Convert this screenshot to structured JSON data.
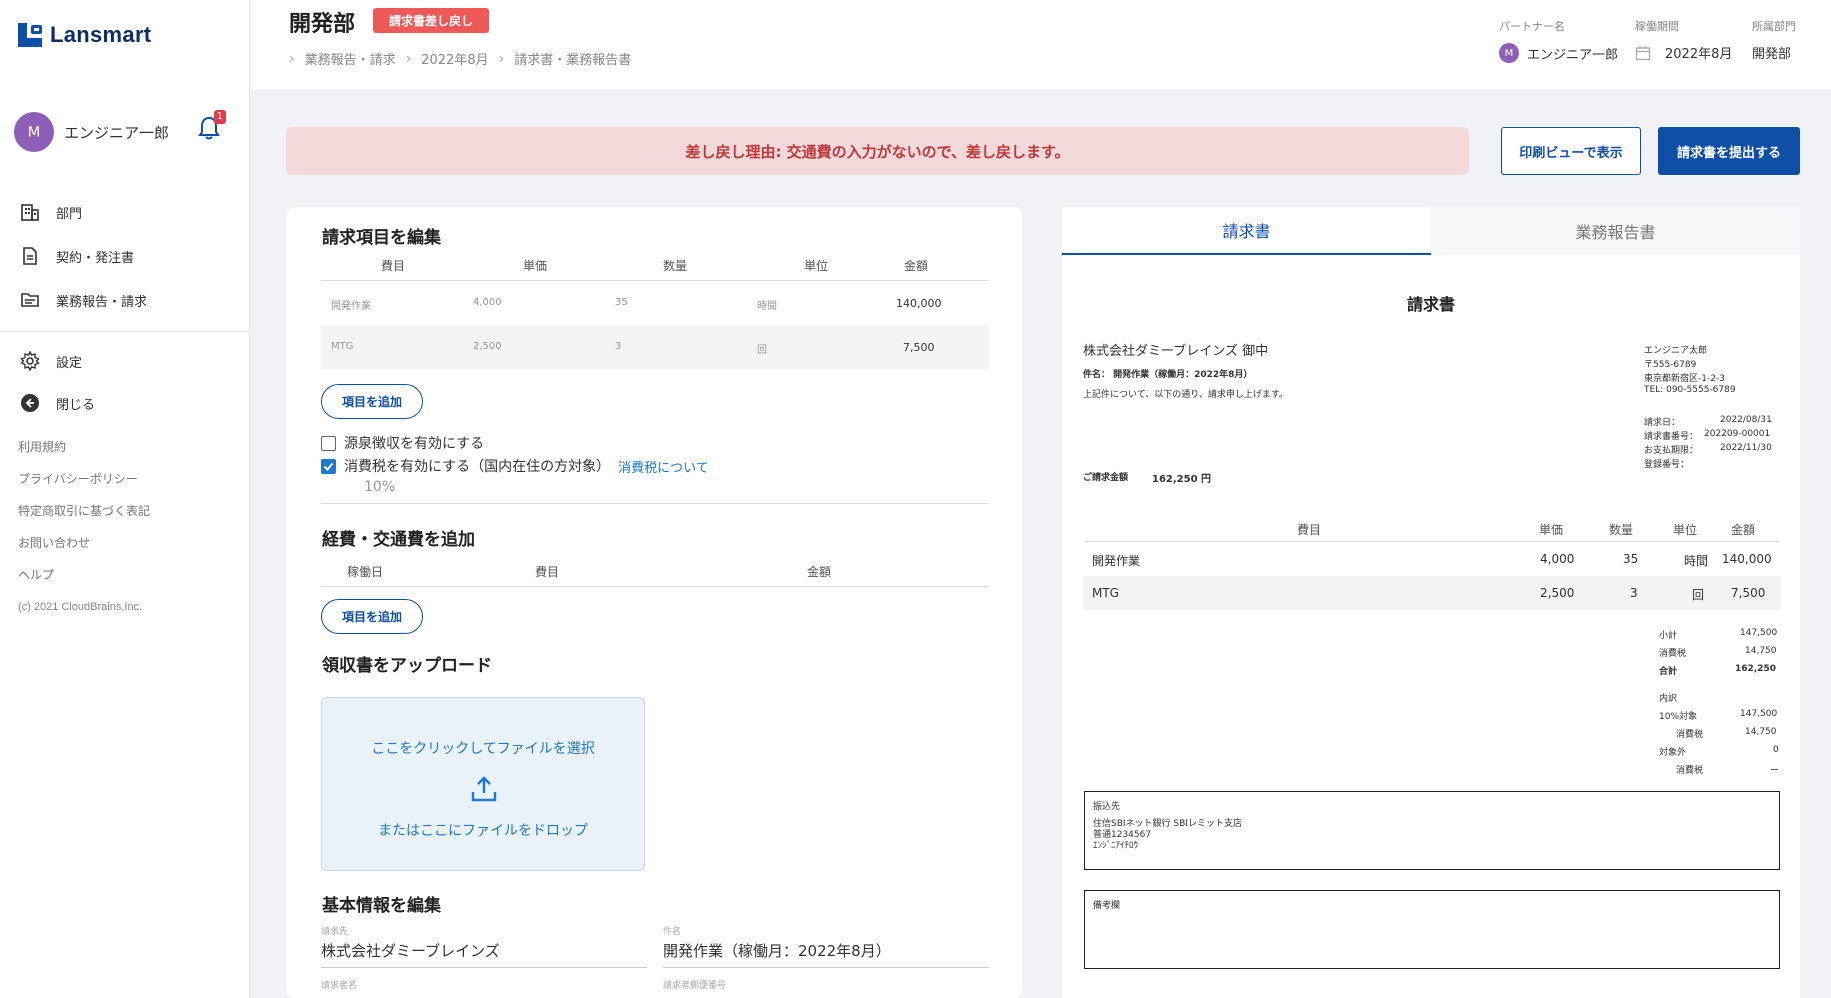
{
  "app": {
    "logo_text": "Lansmart"
  },
  "sidebar": {
    "user": {
      "initial": "M",
      "name": "エンジニア一郎",
      "notifications": "1"
    },
    "nav": [
      {
        "label": "部門",
        "icon": "building-icon"
      },
      {
        "label": "契約・発注書",
        "icon": "document-icon"
      },
      {
        "label": "業務報告・請求",
        "icon": "folder-icon"
      },
      {
        "label": "設定",
        "icon": "gear-icon"
      },
      {
        "label": "閉じる",
        "icon": "back-arrow-icon"
      }
    ],
    "links": [
      "利用規約",
      "プライバシーポリシー",
      "特定商取引に基づく表記",
      "お問い合わせ",
      "ヘルプ"
    ],
    "copyright": "(c) 2021 CloudBrains,Inc."
  },
  "header": {
    "title": "開発部",
    "status": "請求書差し戻し",
    "breadcrumb": [
      "業務報告・請求",
      "2022年8月",
      "請求書・業務報告書"
    ],
    "partner_label": "パートナー名",
    "partner_initial": "M",
    "partner_name": "エンジニア一郎",
    "period_label": "稼働期間",
    "period_value": "2022年8月",
    "dept_label": "所属部門",
    "dept_value": "開発部"
  },
  "alert": {
    "text": "差し戻し理由: 交通費の入力がないので、差し戻します。"
  },
  "actions": {
    "print_view": "印刷ビューで表示",
    "submit": "請求書を提出する"
  },
  "billing": {
    "title": "請求項目を編集",
    "columns": [
      "費目",
      "単価",
      "数量",
      "単位",
      "金額"
    ],
    "rows": [
      {
        "item": "開発作業",
        "unit_price": "4,000",
        "qty": "35",
        "unit": "時間",
        "amount": "140,000"
      },
      {
        "item": "MTG",
        "unit_price": "2,500",
        "qty": "3",
        "unit": "回",
        "amount": "7,500"
      }
    ],
    "add_button": "項目を追加",
    "withholding_label": "源泉徴収を有効にする",
    "tax_label": "消費税を有効にする（国内在住の方対象）",
    "tax_link": "消費税について",
    "tax_rate": "10%"
  },
  "expenses": {
    "title": "経費・交通費を追加",
    "columns": [
      "稼働日",
      "費目",
      "金額"
    ],
    "add_button": "項目を追加"
  },
  "receipt": {
    "title": "領収書をアップロード",
    "click_text": "ここをクリックしてファイルを選択",
    "drop_text": "またはここにファイルをドロップ"
  },
  "basic": {
    "title": "基本情報を編集",
    "to_label": "請求先",
    "to_value": "株式会社ダミーブレインズ",
    "subject_label": "件名",
    "subject_value": "開発作業（稼働月：2022年8月）",
    "name_label": "請求者名",
    "zip_label": "請求者郵便番号"
  },
  "preview": {
    "tabs": [
      "請求書",
      "業務報告書"
    ],
    "doc_title": "請求書",
    "to": "株式会社ダミーブレインズ 御中",
    "subject": "件名： 開発作業（稼働月：2022年8月）",
    "intro": "上記件について、以下の通り、請求申し上げます。",
    "sender": [
      "エンジニア太郎",
      "〒555-6789",
      "東京都新宿区-1-2-3",
      "TEL: 090-5555-6789"
    ],
    "meta": [
      {
        "label": "請求日：",
        "value": "2022/08/31"
      },
      {
        "label": "請求書番号：",
        "value": "202209-00001"
      },
      {
        "label": "お支払期限：",
        "value": "2022/11/30"
      },
      {
        "label": "登録番号：",
        "value": ""
      }
    ],
    "total_label": "ご請求金額",
    "total_value": "162,250 円",
    "columns": [
      "費目",
      "単価",
      "数量",
      "単位",
      "金額"
    ],
    "rows": [
      {
        "item": "開発作業",
        "unit_price": "4,000",
        "qty": "35",
        "unit": "時間",
        "amount": "140,000"
      },
      {
        "item": "MTG",
        "unit_price": "2,500",
        "qty": "3",
        "unit": "回",
        "amount": "7,500"
      }
    ],
    "summary": [
      {
        "label": "小計",
        "value": "147,500"
      },
      {
        "label": "消費税",
        "value": "14,750"
      },
      {
        "label": "合計",
        "value": "162,250"
      }
    ],
    "breakdown_label": "内訳",
    "breakdown": [
      {
        "label": "10%対象",
        "value": "147,500"
      },
      {
        "label": "消費税",
        "value": "14,750"
      },
      {
        "label": "対象外",
        "value": "0"
      },
      {
        "label": "消費税",
        "value": "ー"
      }
    ],
    "bank_label": "振込先",
    "bank_lines": [
      "住信SBIネット銀行 SBIレミット支店",
      "普通1234567",
      "ｴﾝｼﾞﾆｱｲﾁﾛｳ"
    ],
    "notes_label": "備考欄"
  },
  "colors": {
    "primary": "#0d4fa6",
    "danger": "#ef5a58",
    "alert_bg": "#f4d9da"
  }
}
